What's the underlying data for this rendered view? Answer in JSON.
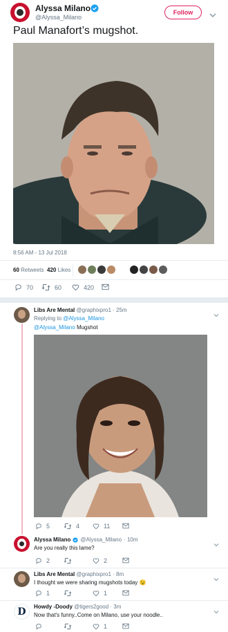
{
  "main_tweet": {
    "author_name": "Alyssa Milano",
    "author_handle": "@Alyssa_Milano",
    "follow_label": "Follow",
    "text": "Paul Manafort’s mugshot.",
    "timestamp": "8:56 AM - 13 Jul 2018",
    "retweets_count": "60",
    "retweets_label": "Retweets",
    "likes_count": "420",
    "likes_label": "Likes",
    "actions": {
      "replies": "70",
      "retweets": "60",
      "likes": "420"
    }
  },
  "reply1": {
    "author_name": "Libs Are Mental",
    "author_handle": "@graphixpro1",
    "time": "· 25m",
    "replying_prefix": "Replying to",
    "replying_to": "@Alyssa_Milano",
    "mention": "@Alyssa_Milano",
    "text": "Mugshot",
    "actions": {
      "replies": "5",
      "retweets": "4",
      "likes": "11"
    }
  },
  "reply2": {
    "author_name": "Alyssa Milano",
    "author_handle": "@Alyssa_Milano",
    "time": "· 10m",
    "text": "Are you really this lame?",
    "actions": {
      "replies": "2",
      "retweets": "",
      "likes": "2"
    }
  },
  "reply3": {
    "author_name": "Libs Are Mental",
    "author_handle": "@graphixpro1",
    "time": "· 8m",
    "text": "I thought we were sharing mugshots today 😉",
    "actions": {
      "replies": "1",
      "retweets": "",
      "likes": "1"
    }
  },
  "reply4": {
    "author_name": "Howdy -Doody",
    "author_handle": "@tigers2good",
    "time": "· 3m",
    "text": "Now that's funny..Come on Milano, use your noodle..",
    "actions": {
      "replies": "",
      "retweets": "",
      "likes": "1"
    }
  },
  "colors": {
    "accent": "#1b95e0",
    "follow": "#e0245e",
    "thread_line": "#f3b6c5",
    "muted": "#657786"
  }
}
